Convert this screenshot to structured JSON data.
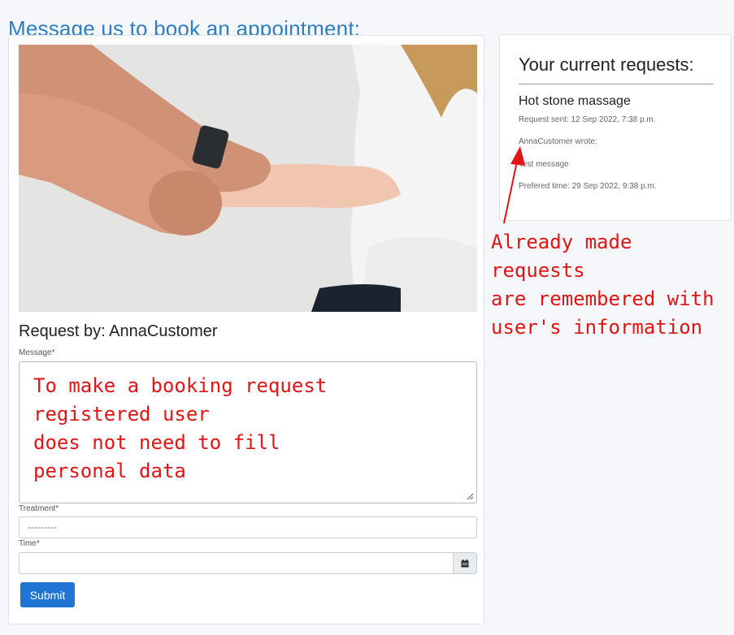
{
  "page": {
    "title": "Message us to book an appointment:"
  },
  "form": {
    "request_by": "Request by: AnnaCustomer",
    "message_label": "Message*",
    "treatment_label": "Treatment*",
    "treatment_selected": "---------",
    "time_label": "Time*",
    "submit_label": "Submit"
  },
  "annotations": {
    "form_note": "To make a booking request\nregistered user\ndoes not need to fill\npersonal data",
    "side_note": "Already made requests\nare remembered with\nuser's information",
    "color": "#e01515"
  },
  "requests": {
    "heading": "Your current requests:",
    "items": [
      {
        "treatment": "Hot stone massage",
        "sent": "Request sent: 12 Sep 2022, 7:38 p.m.",
        "author": "AnnaCustomer wrote:",
        "message": "Test message",
        "preferred": "Prefered time: 29 Sep 2022, 9:38 p.m."
      }
    ]
  },
  "colors": {
    "title": "#2e7ec1",
    "submit": "#1f74d4"
  },
  "icons": {
    "calendar": "calendar-icon",
    "resize": "resize-grip-icon"
  }
}
